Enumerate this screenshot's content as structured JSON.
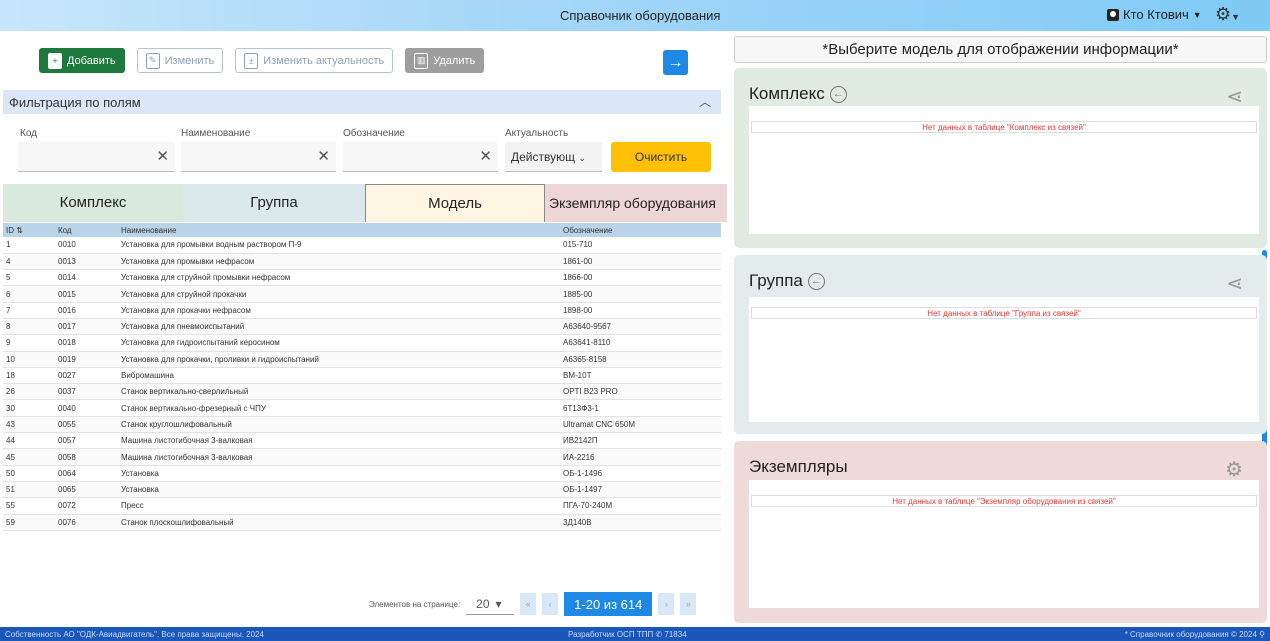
{
  "app": {
    "title": "Справочник оборудования",
    "user": "Кто Ктович"
  },
  "toolbar": {
    "add": "Добавить",
    "edit": "Изменить",
    "edit_relevance": "Изменить актуальность",
    "delete": "Удалить"
  },
  "filter": {
    "title": "Фильтрация по полям",
    "code_label": "Код",
    "name_label": "Наименование",
    "designation_label": "Обозначение",
    "relevance_label": "Актуальность",
    "relevance_value": "Действующ",
    "clear": "Очистить"
  },
  "tabs": [
    "Комплекс",
    "Группа",
    "Модель",
    "Экземпляр оборудования"
  ],
  "table": {
    "headers": [
      "ID",
      "Код",
      "Наименование",
      "Обозначение"
    ],
    "rows": [
      [
        "1",
        "0010",
        "Установка для промывки водным раствором П-9",
        "015-710"
      ],
      [
        "4",
        "0013",
        "Установка для промывки нефрасом",
        "1861-00"
      ],
      [
        "5",
        "0014",
        "Установка для струйной промывки нефрасом",
        "1866-00"
      ],
      [
        "6",
        "0015",
        "Установка для струйной прокачки",
        "1885-00"
      ],
      [
        "7",
        "0016",
        "Установка для прокачки нефрасом",
        "1898-00"
      ],
      [
        "8",
        "0017",
        "Установка для пневмоиспытаний",
        "А63640-9567"
      ],
      [
        "9",
        "0018",
        "Установка для гидроиспытаний керосином",
        "А63641-8110"
      ],
      [
        "10",
        "0019",
        "Установка для прокачки, проливки и гидроиспытаний",
        "А6365-8158"
      ],
      [
        "18",
        "0027",
        "Вибромашина",
        "ВМ-10Т"
      ],
      [
        "26",
        "0037",
        "Станок вертикально-сверлильный",
        "OPTI B23 PRO"
      ],
      [
        "30",
        "0040",
        "Станок вертикально-фрезерный с ЧПУ",
        "6Т13Ф3-1"
      ],
      [
        "43",
        "0055",
        "Станок круглошлифовальный",
        "Ultramat CNC 650M"
      ],
      [
        "44",
        "0057",
        "Машина листогибочная 3-валковая",
        "ИВ2142П"
      ],
      [
        "45",
        "0058",
        "Машина листогибочная 3-валковая",
        "ИА-2216"
      ],
      [
        "50",
        "0064",
        "Установка",
        "ОБ-1-1496"
      ],
      [
        "51",
        "0065",
        "Установка",
        "ОБ-1-1497"
      ],
      [
        "55",
        "0072",
        "Пресс",
        "ПГА-70-240М"
      ],
      [
        "59",
        "0076",
        "Станок плоскошлифовальный",
        "3Д140В"
      ]
    ]
  },
  "pager": {
    "label": "Элементов на странице:",
    "size": "20",
    "range": "1-20 из 614"
  },
  "right": {
    "select_msg": "*Выберите модель для отображении информации*",
    "complex_title": "Комплекс",
    "complex_empty": "Нет данных в таблице \"Комплекс из связей\"",
    "group_title": "Группа",
    "group_empty": "Нет данных в таблице \"Группа из связей\"",
    "instances_title": "Экземпляры",
    "instances_empty": "Нет данных в таблице \"Экземпляр оборудования из связей\""
  },
  "footer": {
    "copyright": "Собственность АО \"ОДК-Авиадвигатель\". Все права защищены. 2024",
    "developer": "Разработчик ОСП ТПП",
    "phone": "71834",
    "product": "* Справочник оборудования © 2024"
  }
}
